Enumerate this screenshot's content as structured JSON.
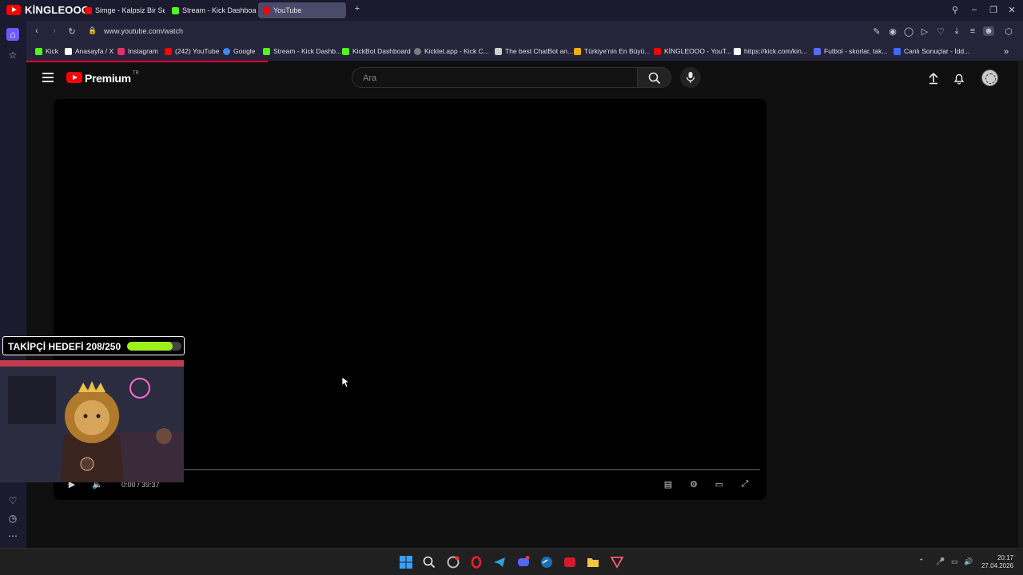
{
  "stream_channel": "KİNGLEOOO",
  "tabs": [
    {
      "label": "Simge - Kalpsiz Bir Serseri",
      "color": "#ff0000",
      "active": false
    },
    {
      "label": "Stream - Kick Dashboard",
      "color": "#53fc18",
      "active": false
    },
    {
      "label": "YouTube",
      "color": "#ff0000",
      "active": true
    }
  ],
  "address_bar": {
    "url": "www.youtube.com/watch"
  },
  "bookmarks": [
    {
      "label": "Kick",
      "color": "#53fc18"
    },
    {
      "label": "Anasayfa / X",
      "color": "#ffffff"
    },
    {
      "label": "Instagram",
      "color": "#e1306c"
    },
    {
      "label": "(242) YouTube",
      "color": "#ff0000"
    },
    {
      "label": "Google",
      "color": "#4285f4"
    },
    {
      "label": "Stream - Kick Dashb...",
      "color": "#53fc18"
    },
    {
      "label": "KickBot Dashboard",
      "color": "#53fc18"
    },
    {
      "label": "Kicklet.app - Kick C...",
      "color": "#7a7a7a"
    },
    {
      "label": "The best ChatBot an...",
      "color": "#cfcfcf"
    },
    {
      "label": "Türkiye'nin En Büyü...",
      "color": "#f0b000"
    },
    {
      "label": "KİNGLEOOO - YouT...",
      "color": "#ff0000"
    },
    {
      "label": "https://kick.com/kin...",
      "color": "#ffffff"
    },
    {
      "label": "Futbol - skorlar, tak...",
      "color": "#5a6cff"
    },
    {
      "label": "Canlı Sonuçlar - İdd...",
      "color": "#3a6cff"
    }
  ],
  "youtube": {
    "logo_text": "Premium",
    "region": "TR",
    "search_placeholder": "Ara"
  },
  "player": {
    "time": "0:00 / 39:37",
    "progress": 0
  },
  "overlay": {
    "follow_goal_label": "TAKİPÇİ HEDEFİ 208/250",
    "follow_current": 208,
    "follow_target": 250
  },
  "taskbar": {
    "time": "20:17",
    "date": "27.04.2026"
  }
}
